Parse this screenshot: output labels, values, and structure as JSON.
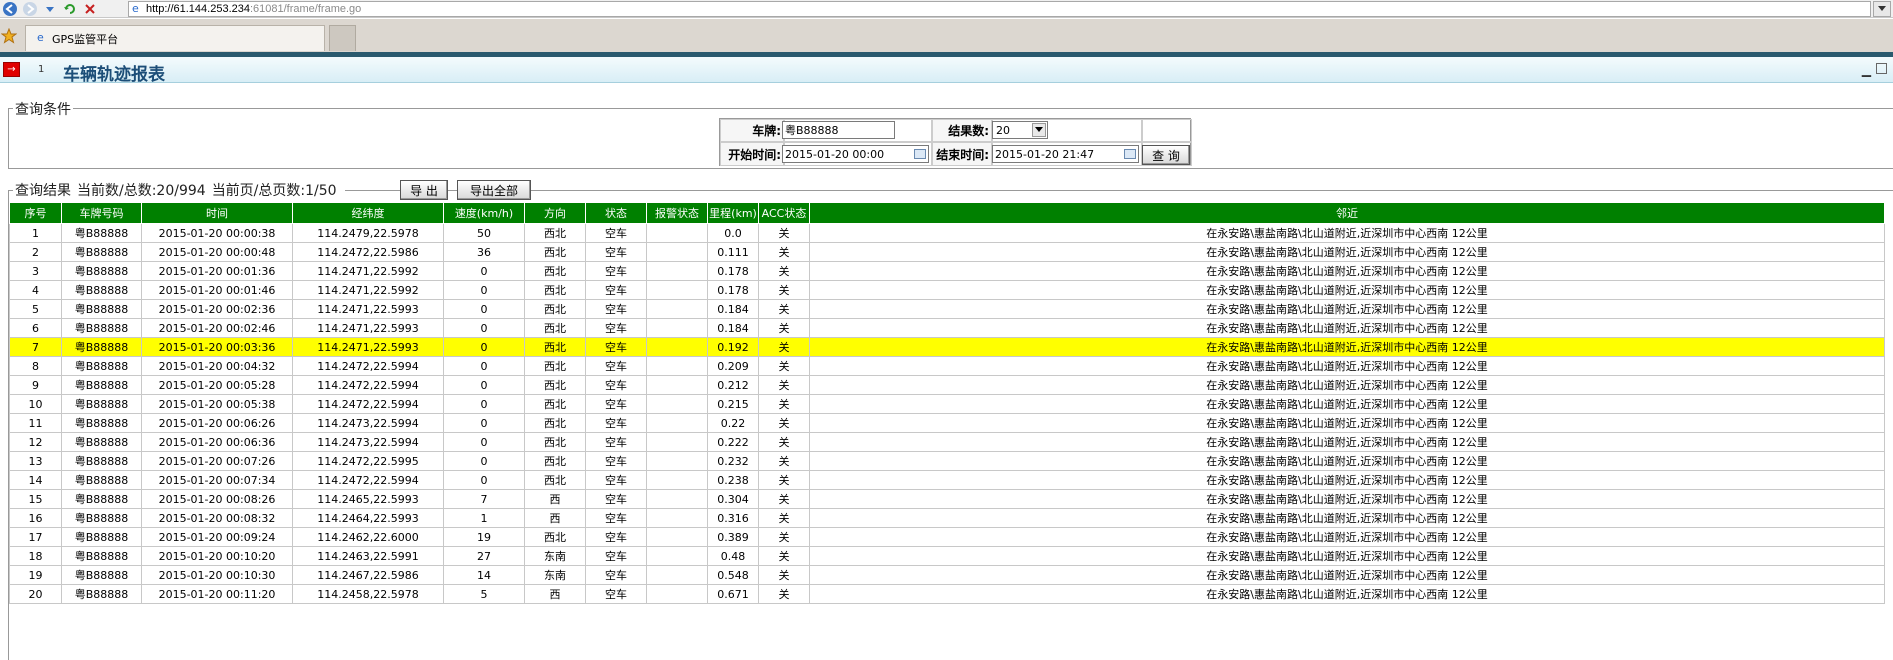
{
  "browser": {
    "url_host": "http://61.144.253.234",
    "url_rest": ":61081/frame/frame.go",
    "tab_title": "GPS监管平台"
  },
  "page": {
    "tab_index": "1",
    "title": "车辆轨迹报表"
  },
  "query": {
    "legend": "查询条件",
    "plate_label": "车牌:",
    "plate_value": "粤B88888",
    "count_label": "结果数:",
    "count_value": "20",
    "start_label": "开始时间:",
    "start_value": "2015-01-20 00:00",
    "end_label": "结束时间:",
    "end_value": "2015-01-20 21:47",
    "query_button": "查 询"
  },
  "results": {
    "legend": "查询结果",
    "current_total": "当前数/总数:20/994",
    "page_total": "当前页/总页数:1/50",
    "export_button": "导 出",
    "export_all_button": "导出全部",
    "columns": [
      "序号",
      "车牌号码",
      "时间",
      "经纬度",
      "速度(km/h)",
      "方向",
      "状态",
      "报警状态",
      "里程(km)",
      "ACC状态",
      "邻近"
    ],
    "selected_row": 7,
    "rows": [
      [
        "1",
        "粤B88888",
        "2015-01-20 00:00:38",
        "114.2479,22.5978",
        "50",
        "西北",
        "空车",
        "",
        "0.0",
        "关",
        "在永安路\\惠盐南路\\北山道附近,近深圳市中心西南 12公里"
      ],
      [
        "2",
        "粤B88888",
        "2015-01-20 00:00:48",
        "114.2472,22.5986",
        "36",
        "西北",
        "空车",
        "",
        "0.111",
        "关",
        "在永安路\\惠盐南路\\北山道附近,近深圳市中心西南 12公里"
      ],
      [
        "3",
        "粤B88888",
        "2015-01-20 00:01:36",
        "114.2471,22.5992",
        "0",
        "西北",
        "空车",
        "",
        "0.178",
        "关",
        "在永安路\\惠盐南路\\北山道附近,近深圳市中心西南 12公里"
      ],
      [
        "4",
        "粤B88888",
        "2015-01-20 00:01:46",
        "114.2471,22.5992",
        "0",
        "西北",
        "空车",
        "",
        "0.178",
        "关",
        "在永安路\\惠盐南路\\北山道附近,近深圳市中心西南 12公里"
      ],
      [
        "5",
        "粤B88888",
        "2015-01-20 00:02:36",
        "114.2471,22.5993",
        "0",
        "西北",
        "空车",
        "",
        "0.184",
        "关",
        "在永安路\\惠盐南路\\北山道附近,近深圳市中心西南 12公里"
      ],
      [
        "6",
        "粤B88888",
        "2015-01-20 00:02:46",
        "114.2471,22.5993",
        "0",
        "西北",
        "空车",
        "",
        "0.184",
        "关",
        "在永安路\\惠盐南路\\北山道附近,近深圳市中心西南 12公里"
      ],
      [
        "7",
        "粤B88888",
        "2015-01-20 00:03:36",
        "114.2471,22.5993",
        "0",
        "西北",
        "空车",
        "",
        "0.192",
        "关",
        "在永安路\\惠盐南路\\北山道附近,近深圳市中心西南 12公里"
      ],
      [
        "8",
        "粤B88888",
        "2015-01-20 00:04:32",
        "114.2472,22.5994",
        "0",
        "西北",
        "空车",
        "",
        "0.209",
        "关",
        "在永安路\\惠盐南路\\北山道附近,近深圳市中心西南 12公里"
      ],
      [
        "9",
        "粤B88888",
        "2015-01-20 00:05:28",
        "114.2472,22.5994",
        "0",
        "西北",
        "空车",
        "",
        "0.212",
        "关",
        "在永安路\\惠盐南路\\北山道附近,近深圳市中心西南 12公里"
      ],
      [
        "10",
        "粤B88888",
        "2015-01-20 00:05:38",
        "114.2472,22.5994",
        "0",
        "西北",
        "空车",
        "",
        "0.215",
        "关",
        "在永安路\\惠盐南路\\北山道附近,近深圳市中心西南 12公里"
      ],
      [
        "11",
        "粤B88888",
        "2015-01-20 00:06:26",
        "114.2473,22.5994",
        "0",
        "西北",
        "空车",
        "",
        "0.22",
        "关",
        "在永安路\\惠盐南路\\北山道附近,近深圳市中心西南 12公里"
      ],
      [
        "12",
        "粤B88888",
        "2015-01-20 00:06:36",
        "114.2473,22.5994",
        "0",
        "西北",
        "空车",
        "",
        "0.222",
        "关",
        "在永安路\\惠盐南路\\北山道附近,近深圳市中心西南 12公里"
      ],
      [
        "13",
        "粤B88888",
        "2015-01-20 00:07:26",
        "114.2472,22.5995",
        "0",
        "西北",
        "空车",
        "",
        "0.232",
        "关",
        "在永安路\\惠盐南路\\北山道附近,近深圳市中心西南 12公里"
      ],
      [
        "14",
        "粤B88888",
        "2015-01-20 00:07:34",
        "114.2472,22.5994",
        "0",
        "西北",
        "空车",
        "",
        "0.238",
        "关",
        "在永安路\\惠盐南路\\北山道附近,近深圳市中心西南 12公里"
      ],
      [
        "15",
        "粤B88888",
        "2015-01-20 00:08:26",
        "114.2465,22.5993",
        "7",
        "西",
        "空车",
        "",
        "0.304",
        "关",
        "在永安路\\惠盐南路\\北山道附近,近深圳市中心西南 12公里"
      ],
      [
        "16",
        "粤B88888",
        "2015-01-20 00:08:32",
        "114.2464,22.5993",
        "1",
        "西",
        "空车",
        "",
        "0.316",
        "关",
        "在永安路\\惠盐南路\\北山道附近,近深圳市中心西南 12公里"
      ],
      [
        "17",
        "粤B88888",
        "2015-01-20 00:09:24",
        "114.2462,22.6000",
        "19",
        "西北",
        "空车",
        "",
        "0.389",
        "关",
        "在永安路\\惠盐南路\\北山道附近,近深圳市中心西南 12公里"
      ],
      [
        "18",
        "粤B88888",
        "2015-01-20 00:10:20",
        "114.2463,22.5991",
        "27",
        "东南",
        "空车",
        "",
        "0.48",
        "关",
        "在永安路\\惠盐南路\\北山道附近,近深圳市中心西南 12公里"
      ],
      [
        "19",
        "粤B88888",
        "2015-01-20 00:10:30",
        "114.2467,22.5986",
        "14",
        "东南",
        "空车",
        "",
        "0.548",
        "关",
        "在永安路\\惠盐南路\\北山道附近,近深圳市中心西南 12公里"
      ],
      [
        "20",
        "粤B88888",
        "2015-01-20 00:11:20",
        "114.2458,22.5978",
        "5",
        "西",
        "空车",
        "",
        "0.671",
        "关",
        "在永安路\\惠盐南路\\北山道附近,近深圳市中心西南 12公里"
      ]
    ]
  },
  "colors": {
    "header_bg": "#008000",
    "selected_row_bg": "#ffff00",
    "title_text": "#1c4e78"
  }
}
